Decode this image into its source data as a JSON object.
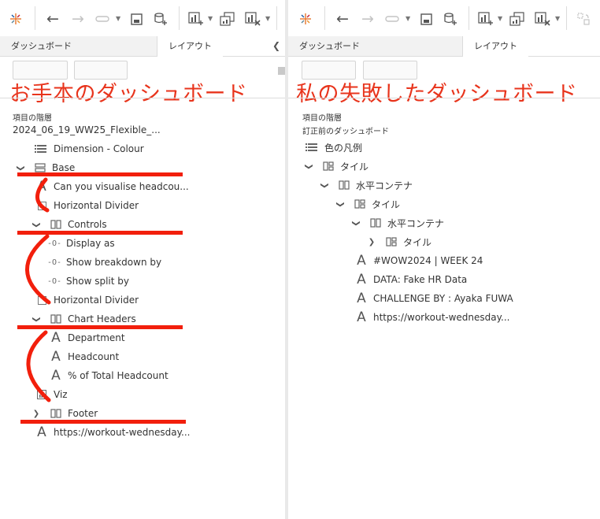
{
  "left": {
    "tabs": {
      "dashboard": "ダッシュボード",
      "layout": "レイアウト"
    },
    "overlay_title": "お手本のダッシュボード",
    "section_label": "項目の階層",
    "root_label": "2024_06_19_WW25_Flexible_...",
    "items": [
      {
        "label": "Dimension - Colour",
        "icon": "legend-list-icon"
      },
      {
        "label": "Base",
        "icon": "vertical-container-icon"
      },
      {
        "label": "Can you visualise headcou...",
        "icon": "text-icon"
      },
      {
        "label": "Horizontal Divider",
        "icon": "blank-icon"
      },
      {
        "label": "Controls",
        "icon": "horizontal-container-icon"
      },
      {
        "label": "Display as",
        "icon": "parameter-icon"
      },
      {
        "label": "Show breakdown by",
        "icon": "parameter-icon"
      },
      {
        "label": "Show split by",
        "icon": "parameter-icon"
      },
      {
        "label": "Horizontal Divider",
        "icon": "blank-icon"
      },
      {
        "label": "Chart Headers",
        "icon": "horizontal-container-icon"
      },
      {
        "label": "Department",
        "icon": "text-icon"
      },
      {
        "label": "Headcount",
        "icon": "text-icon"
      },
      {
        "label": "% of Total Headcount",
        "icon": "text-icon"
      },
      {
        "label": "Viz",
        "icon": "worksheet-icon"
      },
      {
        "label": "Footer",
        "icon": "horizontal-container-icon"
      },
      {
        "label": "https://workout-wednesday...",
        "icon": "text-icon"
      }
    ]
  },
  "right": {
    "tabs": {
      "dashboard": "ダッシュボード",
      "layout": "レイアウト"
    },
    "overlay_title": "私の失敗したダッシュボード",
    "section_label": "項目の階層",
    "root_label": "訂正前のダッシュボード",
    "items": [
      {
        "label": "色の凡例",
        "icon": "legend-list-icon"
      },
      {
        "label": "タイル",
        "icon": "tiled-icon"
      },
      {
        "label": "水平コンテナ",
        "icon": "horizontal-container-icon"
      },
      {
        "label": "タイル",
        "icon": "tiled-icon"
      },
      {
        "label": "水平コンテナ",
        "icon": "horizontal-container-icon"
      },
      {
        "label": "タイル",
        "icon": "tiled-icon"
      },
      {
        "label": "#WOW2024 | WEEK 24",
        "icon": "text-icon"
      },
      {
        "label": "DATA: Fake HR Data",
        "icon": "text-icon"
      },
      {
        "label": "CHALLENGE BY : Ayaka FUWA",
        "icon": "text-icon"
      },
      {
        "label": "https://workout-wednesday...",
        "icon": "text-icon"
      }
    ]
  },
  "toolbar": {
    "icons": [
      "tableau-logo-icon",
      "undo-icon",
      "redo-icon",
      "swap-icon",
      "save-icon",
      "new-datasource-icon",
      "new-worksheet-icon",
      "duplicate-icon",
      "clear-icon",
      "swap-axes-icon"
    ]
  },
  "colors": {
    "annotation_red": "#f21f0c",
    "title_red": "#e8341c",
    "tableau_orange": "#e8762d",
    "tableau_blue": "#1f5fa8"
  }
}
